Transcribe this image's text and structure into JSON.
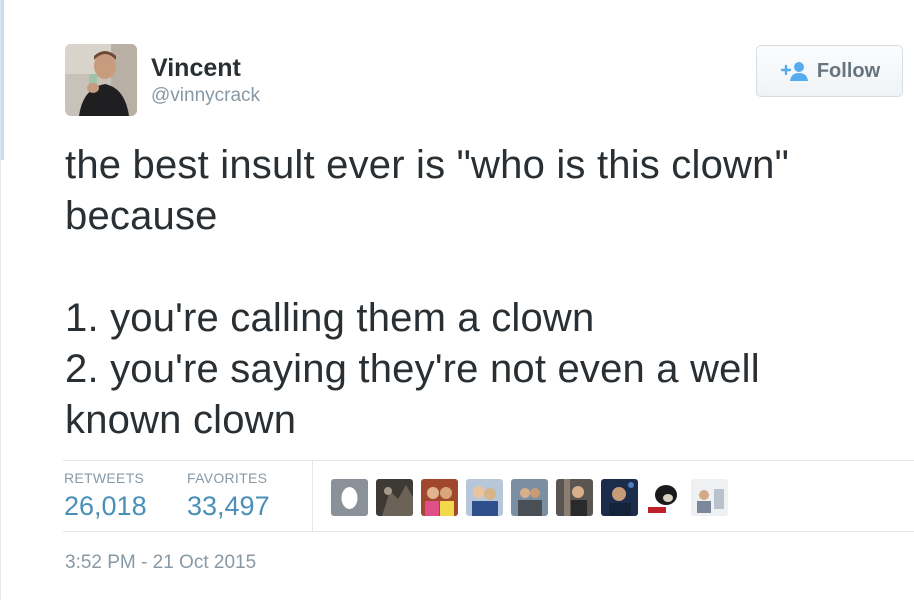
{
  "user": {
    "name": "Vincent",
    "handle": "@vinnycrack",
    "avatar_icon": "user-avatar-photo"
  },
  "follow_button": {
    "label": "Follow",
    "icon": "add-user-icon",
    "icon_color": "#55acee"
  },
  "tweet": {
    "text": "the best insult ever is \"who is this clown\" because\n\n1. you're calling them a clown\n2. you're saying they're not even a well known clown"
  },
  "stats": {
    "retweets_label": "RETWEETS",
    "retweets_value": "26,018",
    "favorites_label": "FAVORITES",
    "favorites_value": "33,497"
  },
  "favoriters": [
    {
      "name": "favoriter-avatar-1",
      "kind": "default-egg"
    },
    {
      "name": "favoriter-avatar-2",
      "kind": "photo"
    },
    {
      "name": "favoriter-avatar-3",
      "kind": "photo"
    },
    {
      "name": "favoriter-avatar-4",
      "kind": "photo"
    },
    {
      "name": "favoriter-avatar-5",
      "kind": "photo"
    },
    {
      "name": "favoriter-avatar-6",
      "kind": "photo"
    },
    {
      "name": "favoriter-avatar-7",
      "kind": "photo"
    },
    {
      "name": "favoriter-avatar-8",
      "kind": "photo"
    },
    {
      "name": "favoriter-avatar-9",
      "kind": "photo"
    }
  ],
  "timestamp": "3:52 PM - 21 Oct 2015",
  "colors": {
    "text": "#292f33",
    "muted": "#8899a6",
    "stat_value": "#4a8fb8",
    "border": "#e1e8ed"
  }
}
